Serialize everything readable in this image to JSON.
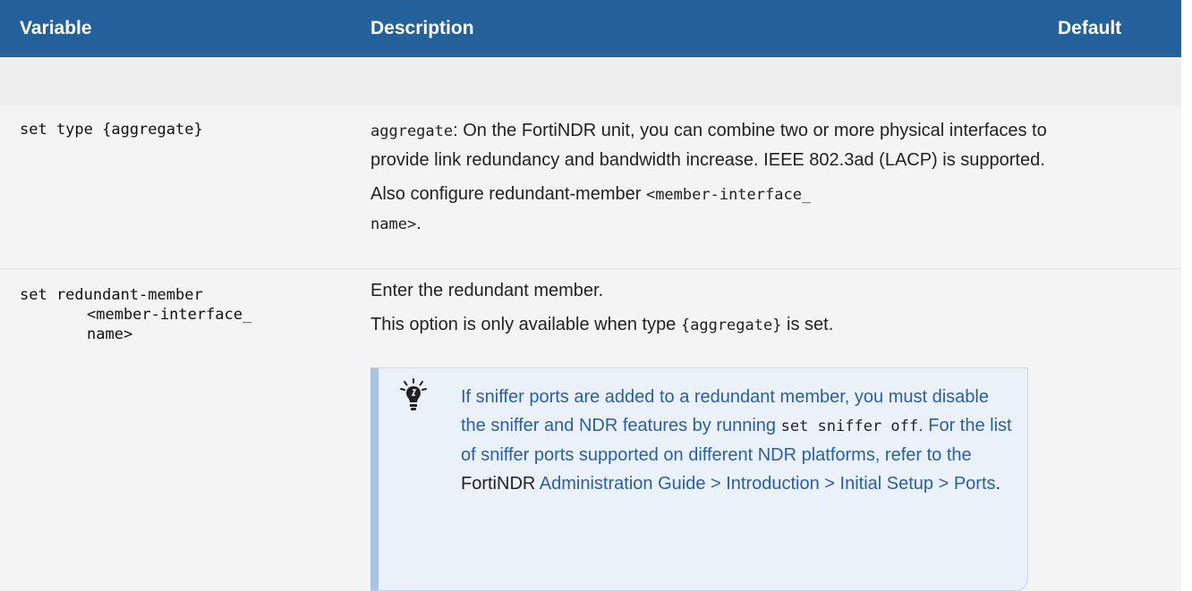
{
  "headers": {
    "variable": "Variable",
    "description": "Description",
    "default": "Default"
  },
  "rows": [
    {
      "variable": "set type {aggregate}",
      "desc": {
        "line1_code": "aggregate",
        "line1_text": ": On the FortiNDR unit, you can combine two or more physical interfaces to provide link redundancy and bandwidth increase. IEEE 802.3ad (LACP) is supported.",
        "line2_text": "Also configure redundant-member ",
        "line2_code_a": "<member-interface_",
        "line2_code_b": "name>",
        "line2_end": "."
      },
      "default": ""
    },
    {
      "variable_lines": [
        "set redundant-member",
        "<member-interface_",
        "name>"
      ],
      "desc": {
        "line1": "Enter the redundant member.",
        "line2_text": "This option is only available when type ",
        "line2_code": "{aggregate}",
        "line2_end": " is set."
      },
      "note": {
        "icon": "lightbulb-icon",
        "text_a": "If sniffer ports are added to a redundant member, you must disable the sniffer and NDR features by running ",
        "code": "set sniffer off",
        "text_b": ". For the list of sniffer ports supported on different NDR platforms, refer to the ",
        "text_c": "FortiNDR",
        "link": "Administration Guide > Introduction > Initial Setup > Ports",
        "end": "."
      },
      "default": ""
    }
  ],
  "colors": {
    "header_bg": "#24619a",
    "note_bg": "#eaf1f9",
    "note_border": "#a9c3e1",
    "link": "#2a5fa0"
  }
}
